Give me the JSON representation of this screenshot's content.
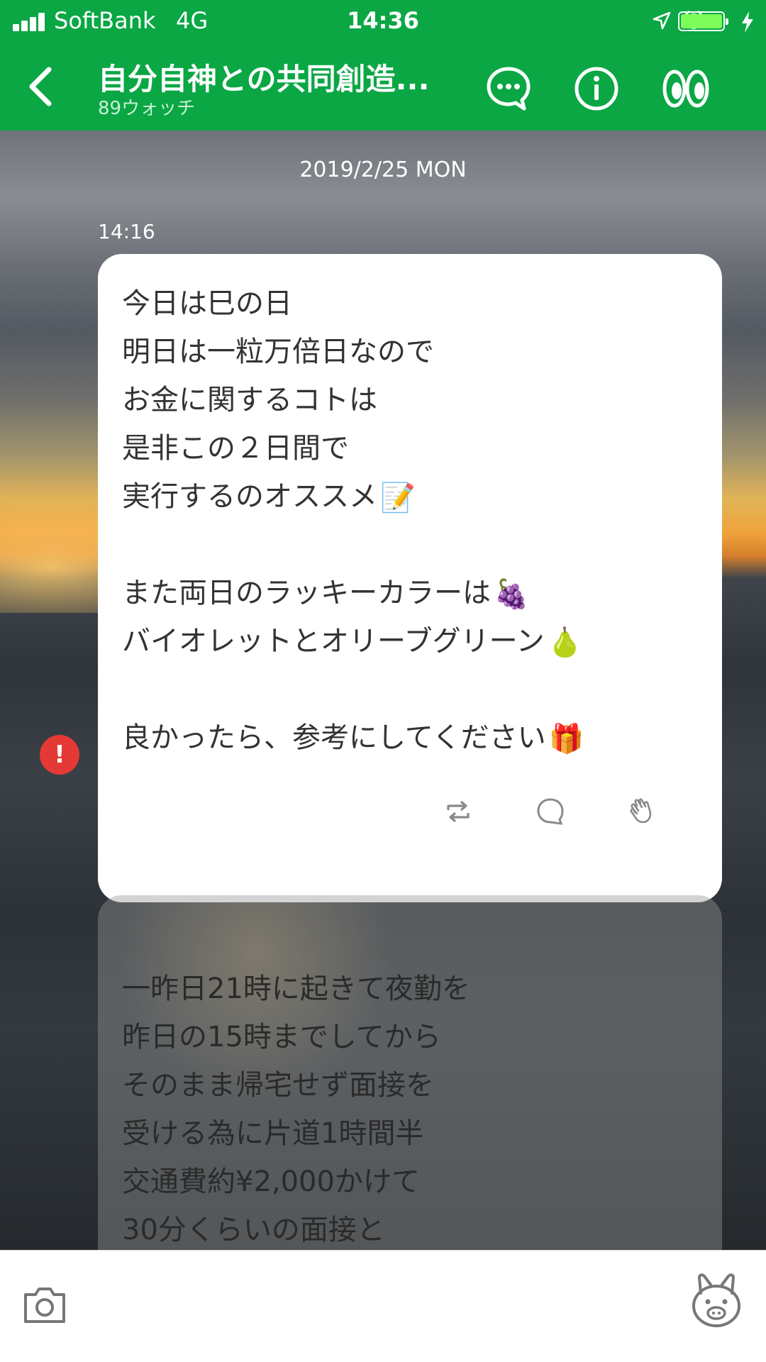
{
  "status": {
    "carrier": "SoftBank",
    "network": "4G",
    "time": "14:36"
  },
  "header": {
    "title": "自分自神との共同創造...",
    "subtitle": "89ウォッチ",
    "bg_color": "#0aa744"
  },
  "chat": {
    "date": "2019/2/25 MON",
    "message_time": "14:16",
    "message_lines": [
      "今日は巳の日",
      "明日は一粒万倍日なので",
      "お金に関するコトは",
      "是非この２日間で",
      "実行するのオススメ",
      "",
      "また両日のラッキーカラーは",
      "バイオレットとオリーブグリーン",
      "",
      "良かったら、参考にしてください"
    ],
    "emojis": {
      "memo": "📝",
      "grapes": "🍇",
      "pear": "🍐",
      "gift": "🎁"
    },
    "error_badge": "!",
    "next_message_lines": [
      "一昨日21時に起きて夜勤を",
      "昨日の15時までしてから",
      "そのまま帰宅せず面接を",
      "受ける為に片道1時間半",
      "交通費約¥2,000かけて",
      "30分くらいの面接と"
    ]
  },
  "icons": {
    "back": "chevron-left-icon",
    "chat": "chat-bubble-icon",
    "info": "info-icon",
    "watch": "eyes-icon",
    "share": "repeat-icon",
    "comment": "comment-icon",
    "clap": "clap-icon",
    "more": "chevron-right-icon",
    "camera": "camera-icon",
    "sticker": "sticker-icon"
  }
}
